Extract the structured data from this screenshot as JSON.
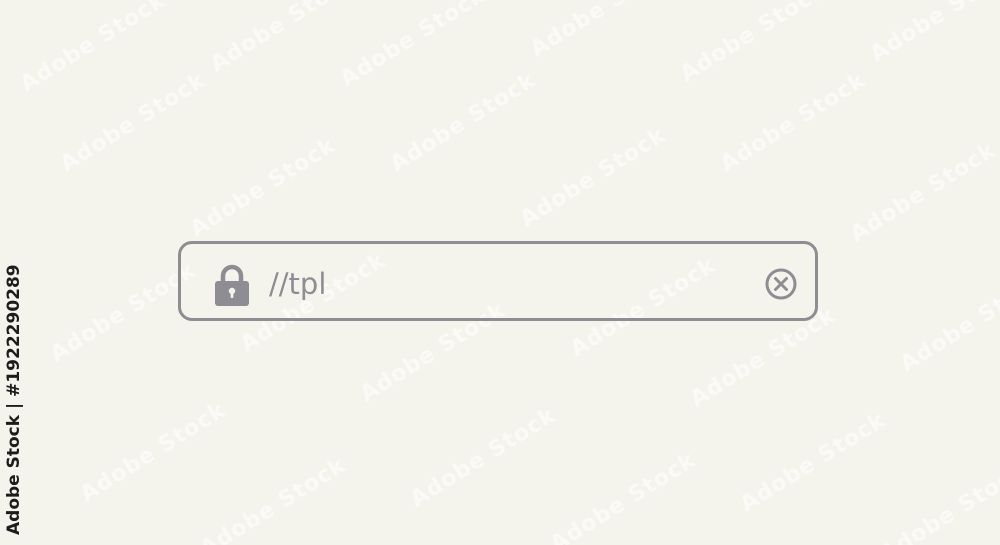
{
  "address_bar": {
    "url_text": "//tpl",
    "lock_icon": "lock-icon",
    "clear_icon": "clear-circle-x-icon"
  },
  "watermark": {
    "text": "Adobe Stock"
  },
  "credit": {
    "text": "Adobe Stock | #1922290289"
  },
  "colors": {
    "background": "#f5f4ec",
    "outline": "#8e8d94"
  }
}
